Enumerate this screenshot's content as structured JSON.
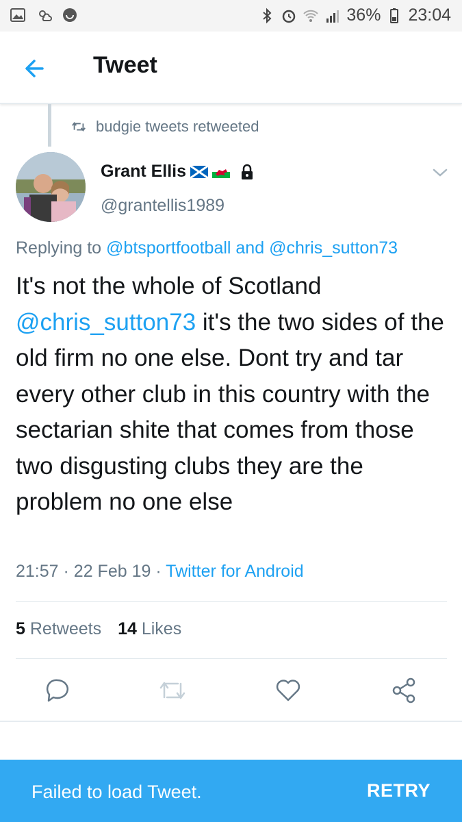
{
  "status_bar": {
    "battery": "36%",
    "time": "23:04",
    "left_icons": [
      "gallery-icon",
      "weather-icon",
      "app-icon"
    ],
    "right_icons": [
      "bluetooth-icon",
      "alarm-icon",
      "wifi-icon",
      "signal-icon",
      "battery-icon"
    ]
  },
  "app_bar": {
    "title": "Tweet"
  },
  "retweet_context": {
    "text": "budgie tweets retweeted"
  },
  "tweet": {
    "display_name": "Grant Ellis",
    "handle": "@grantellis1989",
    "replying_prefix": "Replying to",
    "replying_users": [
      "@btsportfootball",
      "@chris_sutton73"
    ],
    "replying_and": "and",
    "text_part1": "It's not the whole of Scotland",
    "mention": "@chris_sutton73",
    "text_part2": " it's the two sides of the old firm no one else. Dont try and tar every other club in this country with the sectarian shite that comes from those two disgusting clubs they are the problem no one else",
    "time": "21:57",
    "date": "22 Feb 19",
    "separator": "·",
    "source": "Twitter for Android",
    "retweets_count": "5",
    "retweets_label": "Retweets",
    "likes_count": "14",
    "likes_label": "Likes"
  },
  "snackbar": {
    "message": "Failed to load Tweet.",
    "action": "RETRY"
  },
  "colors": {
    "accent": "#1da1f2",
    "snackbar": "#32a9f2",
    "secondary_text": "#657786"
  }
}
